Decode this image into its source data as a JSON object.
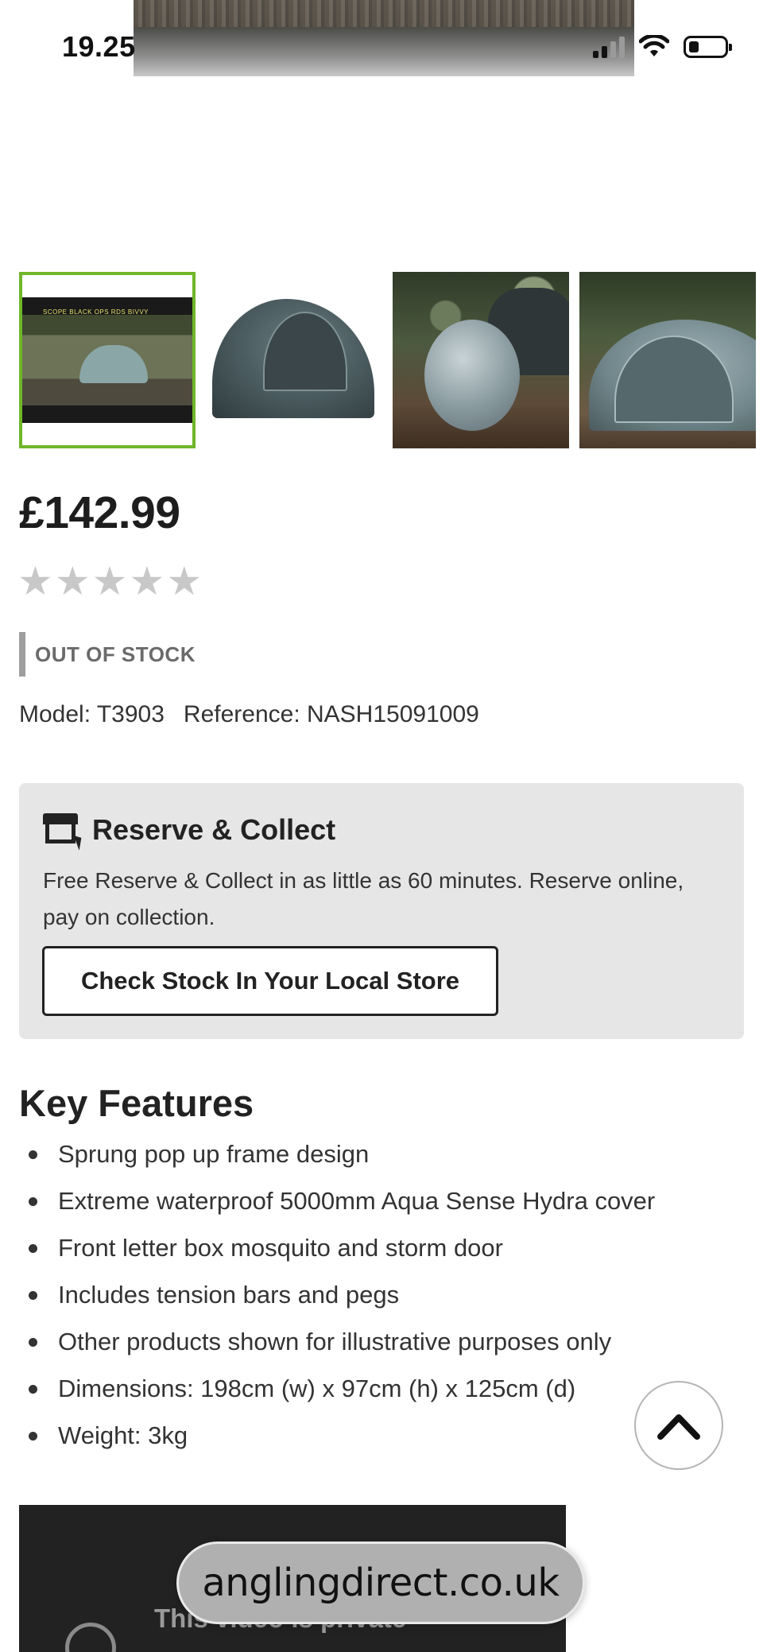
{
  "status_bar": {
    "time": "19.25",
    "signal_icon": "cellular-signal-icon",
    "wifi_icon": "wifi-icon",
    "battery_icon": "battery-icon"
  },
  "gallery": {
    "selected_index": 0,
    "thumbnails": [
      {
        "icon": "video-thumbnail",
        "caption": "SCOPE BLACK OPS RDS BIVVY"
      },
      {
        "icon": "tent-image"
      },
      {
        "icon": "tent-camo-image"
      },
      {
        "icon": "tent-outdoor-image"
      }
    ],
    "accent_color": "#6fb629"
  },
  "product": {
    "price": "£142.99",
    "rating": 0,
    "rating_max": 5,
    "star_glyph": "★",
    "stock_status": "OUT OF STOCK",
    "model": "Model: T3903",
    "reference": "Reference: NASH15091009"
  },
  "reserve_collect": {
    "title": "Reserve & Collect",
    "description": "Free Reserve & Collect in as little as 60 minutes. Reserve online, pay on collection.",
    "button_label": "Check Stock In Your Local Store",
    "icon": "store-click-icon"
  },
  "key_features": {
    "title": "Key Features",
    "items": [
      "Sprung pop up frame design",
      "Extreme waterproof 5000mm Aqua Sense Hydra cover",
      "Front letter box mosquito and storm door",
      "Includes tension bars and pegs",
      "Other products shown for illustrative purposes only",
      "Dimensions: 198cm (w) x 97cm (h) x 125cm (d)",
      "Weight: 3kg"
    ]
  },
  "video": {
    "message": "This video is private"
  },
  "browser": {
    "url": "anglingdirect.co.uk"
  },
  "scroll_top": {
    "icon": "chevron-up-icon"
  }
}
